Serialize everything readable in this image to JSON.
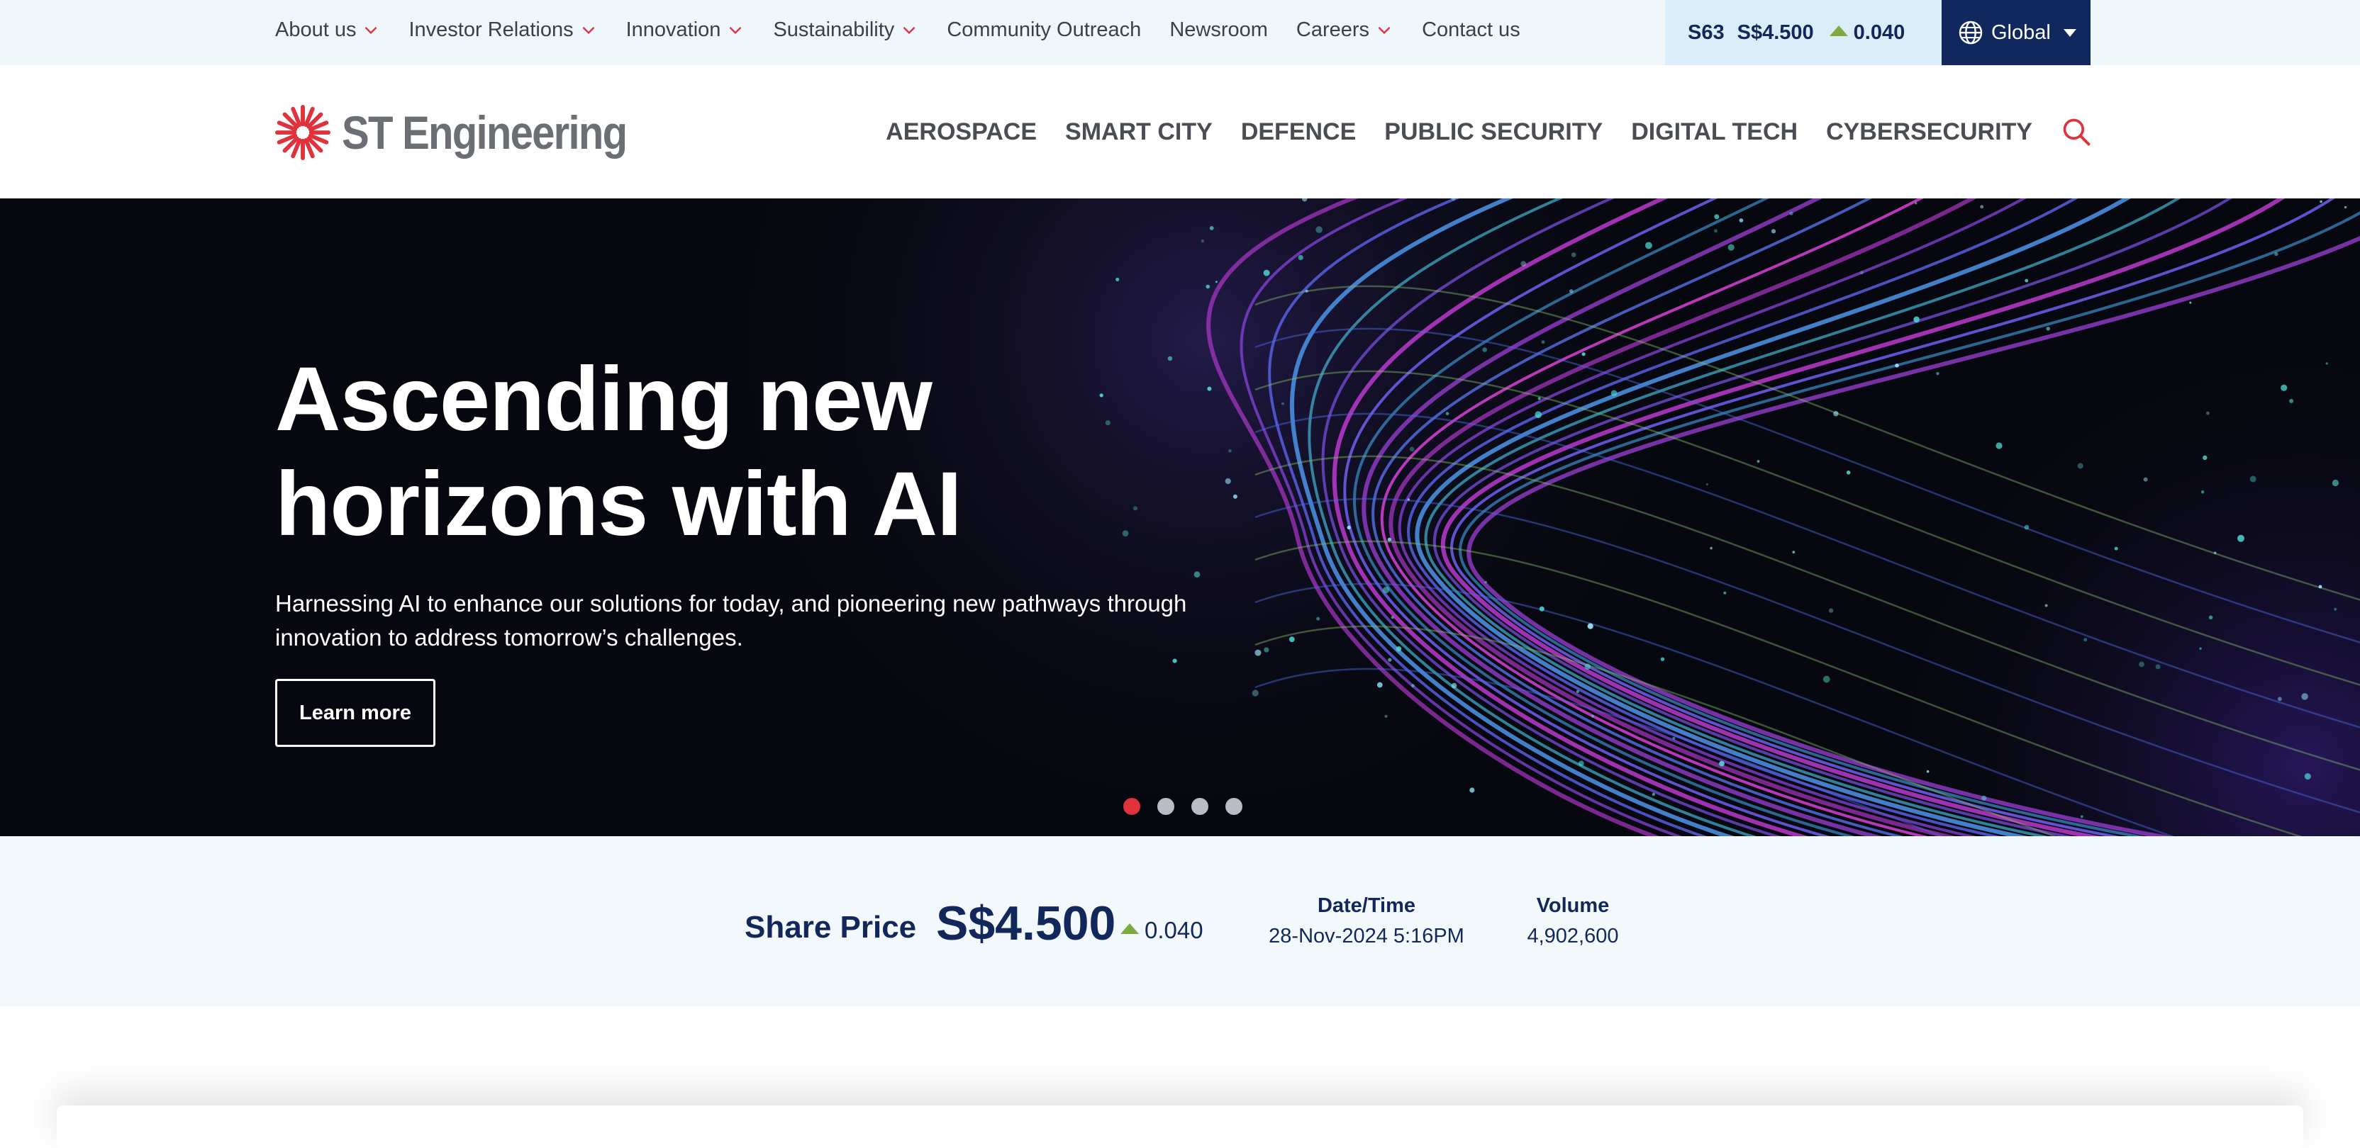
{
  "utility_nav": {
    "items": [
      {
        "label": "About us",
        "dropdown": true
      },
      {
        "label": "Investor Relations",
        "dropdown": true
      },
      {
        "label": "Innovation",
        "dropdown": true
      },
      {
        "label": "Sustainability",
        "dropdown": true
      },
      {
        "label": "Community Outreach",
        "dropdown": false
      },
      {
        "label": "Newsroom",
        "dropdown": false
      },
      {
        "label": "Careers",
        "dropdown": true
      },
      {
        "label": "Contact us",
        "dropdown": false
      }
    ],
    "ticker": {
      "code": "S63",
      "price": "S$4.500",
      "change": "0.040"
    },
    "region_label": "Global"
  },
  "brand": {
    "name": "ST Engineering"
  },
  "main_nav": {
    "items": [
      "AEROSPACE",
      "SMART CITY",
      "DEFENCE",
      "PUBLIC SECURITY",
      "DIGITAL TECH",
      "CYBERSECURITY"
    ]
  },
  "hero": {
    "title_line1": "Ascending new",
    "title_line2": "horizons with AI",
    "subtitle": "Harnessing AI to enhance our solutions for today, and pioneering new pathways through innovation to address tomorrow’s challenges.",
    "cta_label": "Learn more",
    "slides_total": 4,
    "active_slide": 1
  },
  "share_info": {
    "label": "Share Price",
    "price": "S$4.500",
    "change": "0.040",
    "datetime_label": "Date/Time",
    "datetime_value": "28-Nov-2024 5:16PM",
    "volume_label": "Volume",
    "volume_value": "4,902,600"
  },
  "colors": {
    "accent_red": "#e0323c",
    "navy": "#12285a",
    "up_green": "#7cab3f",
    "utility_bg": "#eff7fb"
  }
}
